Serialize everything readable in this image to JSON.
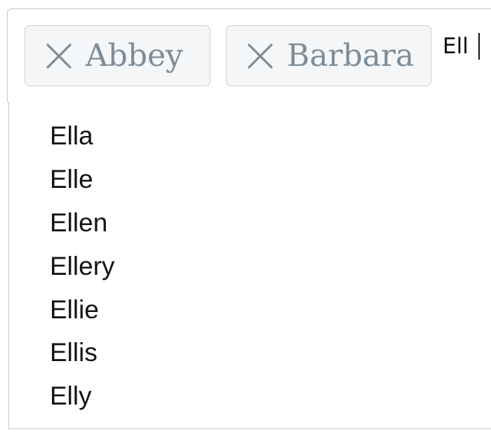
{
  "combobox": {
    "selected_chips": [
      {
        "label": "Abbey",
        "remove_icon": "close-icon"
      },
      {
        "label": "Barbara",
        "remove_icon": "close-icon"
      }
    ],
    "search_value": "Ell"
  },
  "dropdown": {
    "options": [
      "Ella",
      "Elle",
      "Ellen",
      "Ellery",
      "Ellie",
      "Ellis",
      "Elly"
    ]
  },
  "colors": {
    "chip_background": "#f4f6f8",
    "chip_border": "#cbd1d6",
    "chip_text": "#7d8c98",
    "border": "#c3c6ca",
    "text": "#141414"
  }
}
